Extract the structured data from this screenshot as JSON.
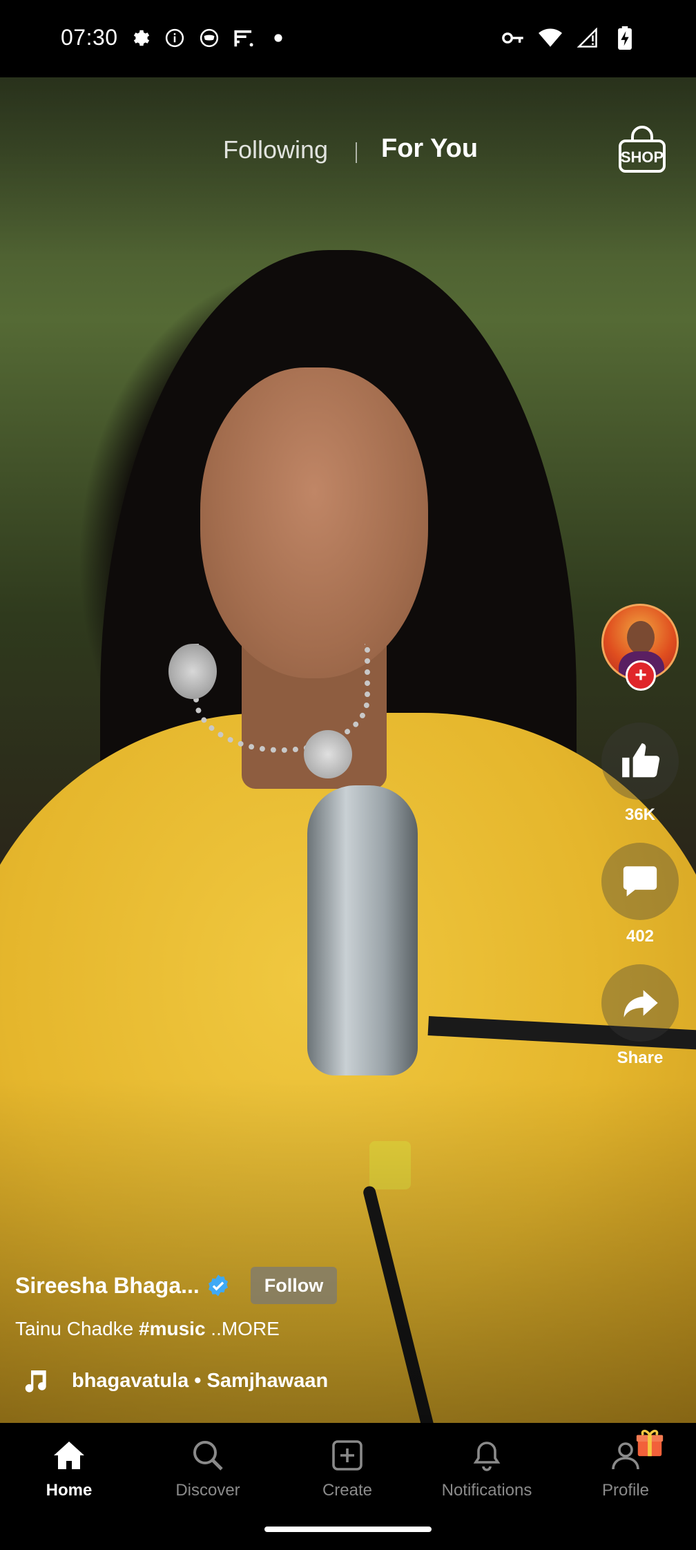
{
  "status_bar": {
    "time": "07:30",
    "left_icons": [
      "settings-icon",
      "info-icon",
      "mask-icon",
      "filter-icon",
      "dot-icon"
    ],
    "right_icons": [
      "vpn-key-icon",
      "wifi-icon",
      "signal-icon",
      "battery-charging-icon"
    ]
  },
  "top_tabs": {
    "following": "Following",
    "for_you": "For You",
    "shop_label": "SHOP"
  },
  "rail": {
    "likes": "36K",
    "comments": "402",
    "share": "Share"
  },
  "video_info": {
    "creator": "Sireesha Bhaga...",
    "follow": "Follow",
    "caption_text": "Tainu Chadke ",
    "caption_tag": "#music",
    "caption_more": " ..MORE",
    "music": "bhagavatula • Samjhawaan"
  },
  "nav": {
    "home": "Home",
    "discover": "Discover",
    "create": "Create",
    "notifications": "Notifications",
    "profile": "Profile"
  },
  "colors": {
    "accent_red": "#e0262a",
    "verified_blue": "#3fa9f5",
    "nav_inactive": "#8a8a8a"
  }
}
